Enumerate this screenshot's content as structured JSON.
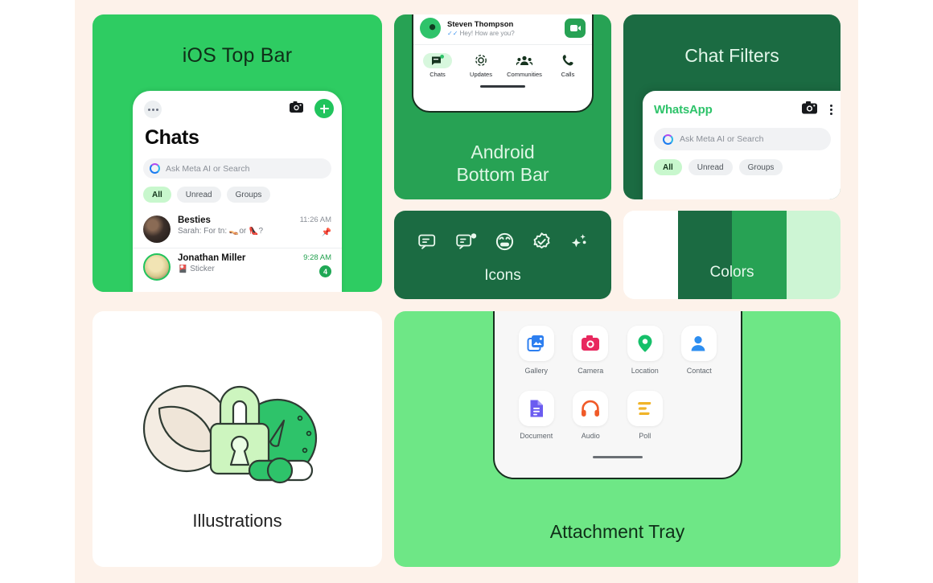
{
  "canvas": {
    "background": "#fdf2ea",
    "outer_background": "#ffffff"
  },
  "cards": {
    "ios_top_bar": {
      "title": "iOS Top Bar",
      "background": "#2ecc62",
      "phone": {
        "header_title": "Chats",
        "icons": {
          "overflow": "more-dots-icon",
          "camera": "camera-icon",
          "compose": "plus-icon"
        },
        "search_placeholder": "Ask Meta AI or Search",
        "filters": [
          "All",
          "Unread",
          "Groups"
        ],
        "active_filter": "All",
        "chats": [
          {
            "name": "Besties",
            "preview": "Sarah: For tn: 👡or 👠?",
            "time": "11:26 AM",
            "pinned": true,
            "unread": ""
          },
          {
            "name": "Jonathan Miller",
            "preview": "🎴 Sticker",
            "time": "9:28 AM",
            "pinned": false,
            "unread": "4"
          }
        ]
      }
    },
    "android_bottom_bar": {
      "title_line1": "Android",
      "title_line2": "Bottom Bar",
      "background": "#27a254",
      "chat": {
        "name": "Steven Thompson",
        "preview": "Hey! How are you?",
        "read_receipt": "double-check-icon",
        "action": "video-camera-icon"
      },
      "nav": [
        {
          "label": "Chats",
          "icon": "chats-icon",
          "active": true
        },
        {
          "label": "Updates",
          "icon": "updates-icon",
          "active": false
        },
        {
          "label": "Communities",
          "icon": "communities-icon",
          "active": false
        },
        {
          "label": "Calls",
          "icon": "calls-icon",
          "active": false
        }
      ]
    },
    "chat_filters": {
      "title": "Chat Filters",
      "background": "#1b6b42",
      "panel": {
        "brand": "WhatsApp",
        "icons": {
          "camera": "camera-icon",
          "overflow": "kebab-menu-icon"
        },
        "search_placeholder": "Ask Meta AI or Search",
        "filters": [
          "All",
          "Unread",
          "Groups"
        ],
        "active_filter": "All"
      }
    },
    "icons": {
      "title": "Icons",
      "background": "#1b6b42",
      "items": [
        "message-icon",
        "new-message-icon",
        "sticker-face-icon",
        "verified-badge-icon",
        "ai-sparkle-icon"
      ]
    },
    "colors": {
      "title": "Colors",
      "swatches": [
        "#ffffff",
        "#1b6b42",
        "#27a254",
        "#cdf5d4"
      ]
    },
    "illustrations": {
      "title": "Illustrations",
      "background": "#ffffff",
      "art": "privacy-lock-illustration"
    },
    "attachment_tray": {
      "title": "Attachment Tray",
      "background": "#6ee786",
      "items": [
        {
          "label": "Gallery",
          "icon": "gallery-icon",
          "color": "#2d7ff0"
        },
        {
          "label": "Camera",
          "icon": "camera-icon",
          "color": "#e8285e"
        },
        {
          "label": "Location",
          "icon": "location-pin-icon",
          "color": "#16c06a"
        },
        {
          "label": "Contact",
          "icon": "contact-icon",
          "color": "#2d8ef0"
        },
        {
          "label": "Document",
          "icon": "document-icon",
          "color": "#6b5cf0"
        },
        {
          "label": "Audio",
          "icon": "headphones-icon",
          "color": "#f05a28"
        },
        {
          "label": "Poll",
          "icon": "poll-icon",
          "color": "#f0b429"
        }
      ]
    }
  }
}
